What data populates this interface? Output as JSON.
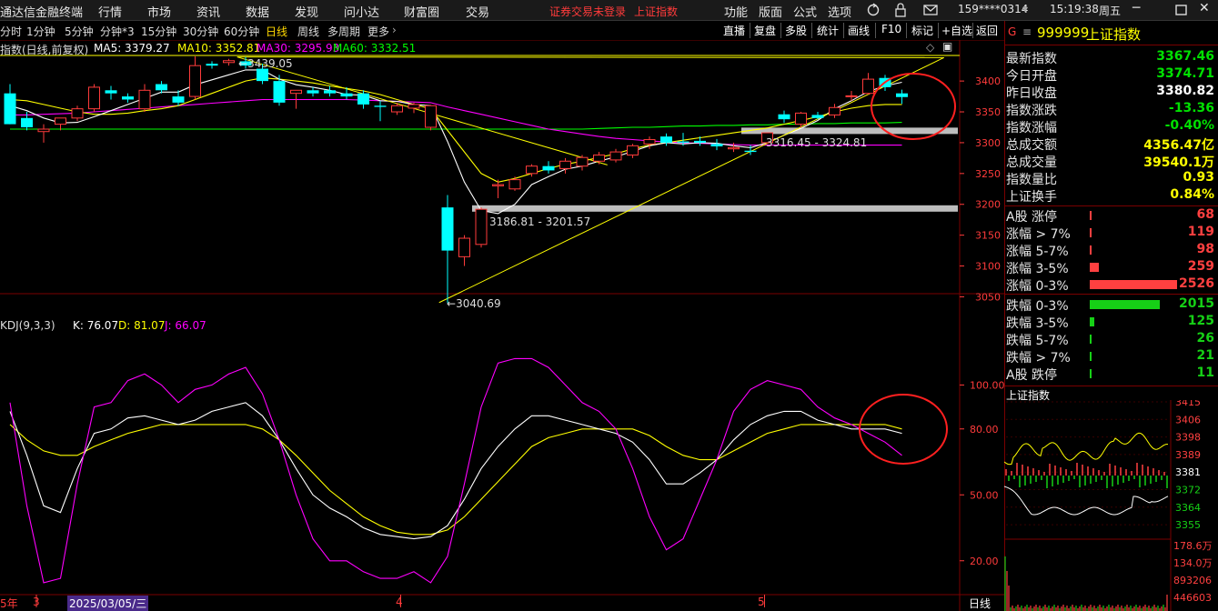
{
  "colors": {
    "up": "#ff3b3b",
    "down": "#00ffff",
    "ma5": "#ffffff",
    "ma10": "#ffff00",
    "ma30": "#ff00ff",
    "ma60": "#00ff00",
    "kdj_k": "#ffffff",
    "kdj_d": "#ffff00",
    "kdj_j": "#ff00ff",
    "axis": "#ff3b3b"
  },
  "menubar": {
    "items": [
      "通达信金融终端",
      "行情",
      "市场",
      "资讯",
      "数据",
      "发现",
      "问小达",
      "财富圈",
      "交易"
    ],
    "warning": "证券交易未登录",
    "status": "上证指数",
    "right_items": [
      "功能",
      "版面",
      "公式",
      "选项"
    ],
    "account": "159****0314",
    "clock": "15:19:38",
    "weekday": "周五"
  },
  "periodbar": {
    "periods": [
      "分时",
      "1分钟",
      "5分钟",
      "分钟*3",
      "15分钟",
      "30分钟",
      "60分钟",
      "日线",
      "周线",
      "多周期",
      "更多"
    ],
    "active": "日线",
    "tools": [
      "直播",
      "复盘",
      "多股",
      "统计",
      "画线",
      "F10",
      "标记",
      "+自选",
      "返回"
    ]
  },
  "main_chart": {
    "label": "指数(日线,前复权)",
    "ma_values": {
      "ma5": "MA5: 3379.27",
      "ma10": "MA10: 3352.81",
      "ma30": "MA30: 3295.93",
      "ma60": "MA60: 3332.51"
    },
    "annotations": {
      "high": "3439.05",
      "low": "3040.69",
      "range_mid": "3186.81 - 3201.57",
      "range_right": "3316.45 - 3324.81"
    },
    "y_ticks": [
      "3400",
      "3350",
      "3300",
      "3250",
      "3200",
      "3150",
      "3100",
      "3050"
    ]
  },
  "chart_data": {
    "type": "candlestick",
    "title": "指数(日线,前复权)",
    "y_range": [
      3030,
      3440
    ],
    "candles": [
      {
        "o": 3380,
        "h": 3395,
        "l": 3330,
        "c": 3330
      },
      {
        "o": 3340,
        "h": 3350,
        "l": 3320,
        "c": 3325
      },
      {
        "o": 3318,
        "h": 3330,
        "l": 3300,
        "c": 3322
      },
      {
        "o": 3330,
        "h": 3340,
        "l": 3320,
        "c": 3340
      },
      {
        "o": 3340,
        "h": 3360,
        "l": 3335,
        "c": 3355
      },
      {
        "o": 3355,
        "h": 3395,
        "l": 3350,
        "c": 3390
      },
      {
        "o": 3385,
        "h": 3392,
        "l": 3370,
        "c": 3380
      },
      {
        "o": 3375,
        "h": 3380,
        "l": 3365,
        "c": 3370
      },
      {
        "o": 3355,
        "h": 3395,
        "l": 3350,
        "c": 3385
      },
      {
        "o": 3395,
        "h": 3400,
        "l": 3380,
        "c": 3385
      },
      {
        "o": 3375,
        "h": 3385,
        "l": 3360,
        "c": 3365
      },
      {
        "o": 3375,
        "h": 3440,
        "l": 3370,
        "c": 3425
      },
      {
        "o": 3428,
        "h": 3432,
        "l": 3420,
        "c": 3425
      },
      {
        "o": 3430,
        "h": 3436,
        "l": 3425,
        "c": 3433
      },
      {
        "o": 3432,
        "h": 3439,
        "l": 3420,
        "c": 3425
      },
      {
        "o": 3420,
        "h": 3428,
        "l": 3395,
        "c": 3400
      },
      {
        "o": 3400,
        "h": 3410,
        "l": 3360,
        "c": 3365
      },
      {
        "o": 3380,
        "h": 3385,
        "l": 3355,
        "c": 3385
      },
      {
        "o": 3385,
        "h": 3390,
        "l": 3375,
        "c": 3380
      },
      {
        "o": 3385,
        "h": 3392,
        "l": 3375,
        "c": 3380
      },
      {
        "o": 3380,
        "h": 3390,
        "l": 3370,
        "c": 3375
      },
      {
        "o": 3380,
        "h": 3385,
        "l": 3355,
        "c": 3362
      },
      {
        "o": 3360,
        "h": 3368,
        "l": 3335,
        "c": 3358
      },
      {
        "o": 3350,
        "h": 3365,
        "l": 3345,
        "c": 3360
      },
      {
        "o": 3356,
        "h": 3365,
        "l": 3348,
        "c": 3362
      },
      {
        "o": 3325,
        "h": 3360,
        "l": 3320,
        "c": 3360
      },
      {
        "o": 3195,
        "h": 3215,
        "l": 3040,
        "c": 3125
      },
      {
        "o": 3115,
        "h": 3150,
        "l": 3100,
        "c": 3145
      },
      {
        "o": 3135,
        "h": 3195,
        "l": 3130,
        "c": 3192
      },
      {
        "o": 3230,
        "h": 3240,
        "l": 3210,
        "c": 3232
      },
      {
        "o": 3225,
        "h": 3245,
        "l": 3222,
        "c": 3240
      },
      {
        "o": 3250,
        "h": 3265,
        "l": 3245,
        "c": 3262
      },
      {
        "o": 3262,
        "h": 3270,
        "l": 3250,
        "c": 3255
      },
      {
        "o": 3258,
        "h": 3275,
        "l": 3250,
        "c": 3270
      },
      {
        "o": 3262,
        "h": 3280,
        "l": 3255,
        "c": 3276
      },
      {
        "o": 3270,
        "h": 3285,
        "l": 3265,
        "c": 3280
      },
      {
        "o": 3272,
        "h": 3290,
        "l": 3268,
        "c": 3285
      },
      {
        "o": 3280,
        "h": 3298,
        "l": 3275,
        "c": 3295
      },
      {
        "o": 3298,
        "h": 3310,
        "l": 3290,
        "c": 3305
      },
      {
        "o": 3310,
        "h": 3315,
        "l": 3295,
        "c": 3300
      },
      {
        "o": 3302,
        "h": 3316,
        "l": 3295,
        "c": 3300
      },
      {
        "o": 3303,
        "h": 3310,
        "l": 3295,
        "c": 3300
      },
      {
        "o": 3298,
        "h": 3306,
        "l": 3288,
        "c": 3294
      },
      {
        "o": 3290,
        "h": 3300,
        "l": 3285,
        "c": 3292
      },
      {
        "o": 3287,
        "h": 3296,
        "l": 3280,
        "c": 3285
      },
      {
        "o": 3300,
        "h": 3316,
        "l": 3298,
        "c": 3316
      },
      {
        "o": 3346,
        "h": 3352,
        "l": 3332,
        "c": 3338
      },
      {
        "o": 3330,
        "h": 3350,
        "l": 3325,
        "c": 3348
      },
      {
        "o": 3345,
        "h": 3350,
        "l": 3338,
        "c": 3340
      },
      {
        "o": 3345,
        "h": 3363,
        "l": 3340,
        "c": 3357
      },
      {
        "o": 3375,
        "h": 3384,
        "l": 3368,
        "c": 3376
      },
      {
        "o": 3380,
        "h": 3413,
        "l": 3378,
        "c": 3403
      },
      {
        "o": 3405,
        "h": 3410,
        "l": 3384,
        "c": 3390
      },
      {
        "o": 3380,
        "h": 3386,
        "l": 3363,
        "c": 3374
      }
    ],
    "ma5": [
      3360,
      3352,
      3340,
      3332,
      3333,
      3342,
      3352,
      3362,
      3372,
      3382,
      3382,
      3394,
      3402,
      3410,
      3418,
      3418,
      3403,
      3394,
      3390,
      3385,
      3378,
      3377,
      3368,
      3367,
      3362,
      3360,
      3302,
      3236,
      3190,
      3185,
      3200,
      3232,
      3245,
      3257,
      3262,
      3270,
      3277,
      3286,
      3295,
      3300,
      3298,
      3300,
      3299,
      3295,
      3292,
      3300,
      3312,
      3323,
      3336,
      3355,
      3368,
      3383,
      3392,
      3398
    ],
    "ma10": [
      3370,
      3368,
      3362,
      3356,
      3350,
      3346,
      3346,
      3348,
      3352,
      3355,
      3360,
      3370,
      3380,
      3390,
      3400,
      3405,
      3403,
      3400,
      3397,
      3392,
      3388,
      3384,
      3378,
      3370,
      3362,
      3355,
      3320,
      3285,
      3250,
      3236,
      3242,
      3250,
      3258,
      3265,
      3270,
      3276,
      3282,
      3290,
      3296,
      3300,
      3304,
      3308,
      3312,
      3316,
      3320,
      3324,
      3330,
      3336,
      3342,
      3350,
      3356,
      3360,
      3362,
      3362
    ],
    "ma30": [
      3345,
      3345,
      3346,
      3347,
      3348,
      3350,
      3352,
      3354,
      3356,
      3358,
      3360,
      3362,
      3364,
      3366,
      3368,
      3370,
      3370,
      3370,
      3370,
      3370,
      3370,
      3369,
      3368,
      3367,
      3366,
      3365,
      3358,
      3352,
      3346,
      3340,
      3334,
      3328,
      3322,
      3318,
      3314,
      3310,
      3307,
      3305,
      3303,
      3301,
      3300,
      3299,
      3298,
      3297,
      3296,
      3296,
      3296,
      3296,
      3296,
      3296,
      3296,
      3296,
      3296,
      3296
    ],
    "ma60": [
      3322,
      3322,
      3322,
      3322,
      3322,
      3322,
      3322,
      3322,
      3322,
      3322,
      3322,
      3322,
      3322,
      3322,
      3322,
      3322,
      3322,
      3322,
      3322,
      3322,
      3322,
      3322,
      3322,
      3322,
      3322,
      3322,
      3322,
      3322,
      3322,
      3322,
      3322,
      3322,
      3322,
      3322,
      3322,
      3323,
      3324,
      3325,
      3325,
      3326,
      3327,
      3327,
      3328,
      3328,
      3329,
      3329,
      3330,
      3330,
      3331,
      3331,
      3332,
      3332,
      3332,
      3333
    ],
    "trendlines": [
      {
        "x1": 25.5,
        "y1": 3040.69,
        "x2": 55.5,
        "y2": 3438
      },
      {
        "x1": 13.5,
        "y1": 3439,
        "x2": 35.5,
        "y2": 3264
      },
      {
        "x1": 13.5,
        "y1": 3439,
        "x2": 55.5,
        "y2": 3438
      }
    ],
    "support_bands": [
      {
        "from_index": 28,
        "y": 3194
      },
      {
        "from_index": 44,
        "y": 3320
      }
    ]
  },
  "kdj": {
    "label": "KDJ(9,3,3)",
    "k_label": "K: 76.07",
    "d_label": "D: 81.07",
    "j_label": "J: 66.07",
    "y_ticks": [
      "100.00",
      "80.00",
      "50.00",
      "20.00"
    ],
    "y_range": [
      5,
      125
    ],
    "k": [
      88,
      68,
      45,
      42,
      62,
      78,
      80,
      85,
      86,
      84,
      82,
      84,
      88,
      90,
      92,
      86,
      75,
      62,
      50,
      44,
      40,
      35,
      32,
      31,
      30,
      31,
      36,
      48,
      62,
      72,
      80,
      86,
      86,
      84,
      82,
      80,
      78,
      74,
      66,
      55,
      55,
      60,
      66,
      75,
      82,
      86,
      88,
      88,
      84,
      82,
      80,
      80,
      80,
      78
    ],
    "d": [
      82,
      75,
      70,
      68,
      68,
      72,
      75,
      78,
      80,
      82,
      82,
      82,
      82,
      82,
      82,
      80,
      75,
      68,
      60,
      52,
      46,
      40,
      36,
      33,
      32,
      32,
      34,
      40,
      48,
      56,
      64,
      72,
      76,
      78,
      80,
      80,
      80,
      80,
      77,
      72,
      68,
      66,
      66,
      70,
      74,
      78,
      80,
      82,
      82,
      82,
      82,
      82,
      82,
      80
    ],
    "j": [
      92,
      45,
      10,
      12,
      55,
      90,
      92,
      102,
      105,
      100,
      92,
      98,
      100,
      105,
      108,
      96,
      75,
      50,
      30,
      20,
      20,
      15,
      12,
      12,
      15,
      10,
      22,
      55,
      90,
      110,
      112,
      112,
      108,
      100,
      92,
      88,
      80,
      62,
      40,
      25,
      30,
      48,
      66,
      88,
      98,
      102,
      100,
      98,
      90,
      85,
      82,
      78,
      74,
      68
    ]
  },
  "x_axis": {
    "labels": [
      "5年",
      "3",
      "2025/03/05/三",
      "4",
      "5"
    ],
    "corner": "日线"
  },
  "right_panel": {
    "title": {
      "symbol": "G",
      "code": "999999",
      "name": "上证指数"
    },
    "quotes": [
      {
        "label": "最新指数",
        "value": "3367.46",
        "color": "#00e000"
      },
      {
        "label": "今日开盘",
        "value": "3374.71",
        "color": "#00e000"
      },
      {
        "label": "昨日收盘",
        "value": "3380.82",
        "color": "#ffffff"
      },
      {
        "label": "指数涨跌",
        "value": "-13.36",
        "color": "#00e000"
      },
      {
        "label": "指数涨幅",
        "value": "-0.40%",
        "color": "#00e000"
      },
      {
        "label": "总成交额",
        "value": "4356.47亿",
        "color": "#ffff00"
      },
      {
        "label": "总成交量",
        "value": "39540.1万",
        "color": "#ffff00"
      },
      {
        "label": "指数量比",
        "value": "0.93",
        "color": "#ffff00"
      },
      {
        "label": "上证换手",
        "value": "0.84%",
        "color": "#ffff00"
      }
    ],
    "stats_up": [
      {
        "label": "A股 涨停",
        "value": "68",
        "ratio": 0.02
      },
      {
        "label": "涨幅 > 7%",
        "value": "119",
        "ratio": 0.02
      },
      {
        "label": "涨幅 5-7%",
        "value": "98",
        "ratio": 0.02
      },
      {
        "label": "涨幅 3-5%",
        "value": "259",
        "ratio": 0.1
      },
      {
        "label": "涨幅 0-3%",
        "value": "2526",
        "ratio": 1.0
      }
    ],
    "stats_down": [
      {
        "label": "跌幅 0-3%",
        "value": "2015",
        "ratio": 0.8
      },
      {
        "label": "跌幅 3-5%",
        "value": "125",
        "ratio": 0.05
      },
      {
        "label": "跌幅 5-7%",
        "value": "26",
        "ratio": 0.01
      },
      {
        "label": "跌幅 > 7%",
        "value": "21",
        "ratio": 0.01
      },
      {
        "label": "A股 跌停",
        "value": "11",
        "ratio": 0.01
      }
    ],
    "mini_chart": {
      "title": "上证指数",
      "y_labels": [
        "3415",
        "3406",
        "3398",
        "3389",
        "3381",
        "3372",
        "3364",
        "3355"
      ],
      "volume_labels": [
        "178.6万",
        "134.0万",
        "893206",
        "446603"
      ]
    }
  }
}
